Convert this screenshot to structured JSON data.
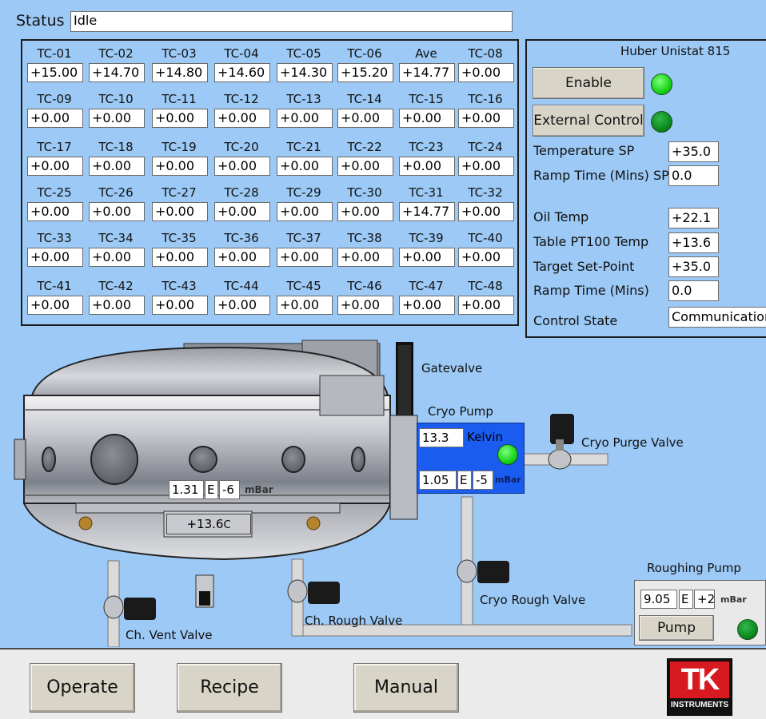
{
  "status": {
    "label": "Status",
    "value": "Idle"
  },
  "thermocouples": [
    {
      "name": "TC-01",
      "value": "+15.00"
    },
    {
      "name": "TC-02",
      "value": "+14.70"
    },
    {
      "name": "TC-03",
      "value": "+14.80"
    },
    {
      "name": "TC-04",
      "value": "+14.60"
    },
    {
      "name": "TC-05",
      "value": "+14.30"
    },
    {
      "name": "TC-06",
      "value": "+15.20"
    },
    {
      "name": "Ave",
      "value": "+14.77"
    },
    {
      "name": "TC-08",
      "value": "+0.00"
    },
    {
      "name": "TC-09",
      "value": "+0.00"
    },
    {
      "name": "TC-10",
      "value": "+0.00"
    },
    {
      "name": "TC-11",
      "value": "+0.00"
    },
    {
      "name": "TC-12",
      "value": "+0.00"
    },
    {
      "name": "TC-13",
      "value": "+0.00"
    },
    {
      "name": "TC-14",
      "value": "+0.00"
    },
    {
      "name": "TC-15",
      "value": "+0.00"
    },
    {
      "name": "TC-16",
      "value": "+0.00"
    },
    {
      "name": "TC-17",
      "value": "+0.00"
    },
    {
      "name": "TC-18",
      "value": "+0.00"
    },
    {
      "name": "TC-19",
      "value": "+0.00"
    },
    {
      "name": "TC-20",
      "value": "+0.00"
    },
    {
      "name": "TC-21",
      "value": "+0.00"
    },
    {
      "name": "TC-22",
      "value": "+0.00"
    },
    {
      "name": "TC-23",
      "value": "+0.00"
    },
    {
      "name": "TC-24",
      "value": "+0.00"
    },
    {
      "name": "TC-25",
      "value": "+0.00"
    },
    {
      "name": "TC-26",
      "value": "+0.00"
    },
    {
      "name": "TC-27",
      "value": "+0.00"
    },
    {
      "name": "TC-28",
      "value": "+0.00"
    },
    {
      "name": "TC-29",
      "value": "+0.00"
    },
    {
      "name": "TC-30",
      "value": "+0.00"
    },
    {
      "name": "TC-31",
      "value": "+14.77"
    },
    {
      "name": "TC-32",
      "value": "+0.00"
    },
    {
      "name": "TC-33",
      "value": "+0.00"
    },
    {
      "name": "TC-34",
      "value": "+0.00"
    },
    {
      "name": "TC-35",
      "value": "+0.00"
    },
    {
      "name": "TC-36",
      "value": "+0.00"
    },
    {
      "name": "TC-37",
      "value": "+0.00"
    },
    {
      "name": "TC-38",
      "value": "+0.00"
    },
    {
      "name": "TC-39",
      "value": "+0.00"
    },
    {
      "name": "TC-40",
      "value": "+0.00"
    },
    {
      "name": "TC-41",
      "value": "+0.00"
    },
    {
      "name": "TC-42",
      "value": "+0.00"
    },
    {
      "name": "TC-43",
      "value": "+0.00"
    },
    {
      "name": "TC-44",
      "value": "+0.00"
    },
    {
      "name": "TC-45",
      "value": "+0.00"
    },
    {
      "name": "TC-46",
      "value": "+0.00"
    },
    {
      "name": "TC-47",
      "value": "+0.00"
    },
    {
      "name": "TC-48",
      "value": "+0.00"
    }
  ],
  "huber": {
    "title": "Huber Unistat 815",
    "enable_label": "Enable",
    "external_control_label": "External Control",
    "temperature_sp_label": "Temperature SP",
    "temperature_sp": "+35.0",
    "ramp_time_sp_label": "Ramp Time (Mins) SP",
    "ramp_time_sp": "0.0",
    "oil_temp_label": "Oil Temp",
    "oil_temp": "+22.1",
    "table_temp_label": "Table PT100 Temp",
    "table_temp": "+13.6",
    "target_sp_label": "Target Set-Point",
    "target_sp": "+35.0",
    "ramp_time_label": "Ramp Time (Mins)",
    "ramp_time": "0.0",
    "control_state_label": "Control State",
    "control_state": "Communication",
    "colors": {
      "led_bright": "#1ed81e",
      "led_dark": "#0c8a1c"
    }
  },
  "chamber": {
    "pressure_mantissa": "1.31",
    "pressure_e": "E",
    "pressure_exp": "-6",
    "pressure_unit": "mBar",
    "table_temp": "+13.6",
    "table_temp_unit": "C"
  },
  "gatevalve": {
    "label": "Gatevalve"
  },
  "cryo": {
    "label": "Cryo Pump",
    "temp": "13.3",
    "temp_unit": "Kelvin",
    "pressure_mantissa": "1.05",
    "pressure_e": "E",
    "pressure_exp": "-5",
    "pressure_unit": "mBar",
    "purge_valve_label": "Cryo Purge Valve",
    "rough_valve_label": "Cryo Rough Valve",
    "panel_color": "#1a5cf0"
  },
  "valves": {
    "vent": "Ch. Vent Valve",
    "rough": "Ch. Rough Valve"
  },
  "roughing": {
    "title": "Roughing Pump",
    "pressure_mantissa": "9.05",
    "pressure_e": "E",
    "pressure_exp": "+2",
    "pressure_unit": "mBar",
    "pump_label": "Pump"
  },
  "nav": {
    "operate": "Operate",
    "recipe": "Recipe",
    "manual": "Manual"
  },
  "logo": {
    "text_big": "TK",
    "text_small": "INSTRUMENTS",
    "color": "#d71920"
  }
}
